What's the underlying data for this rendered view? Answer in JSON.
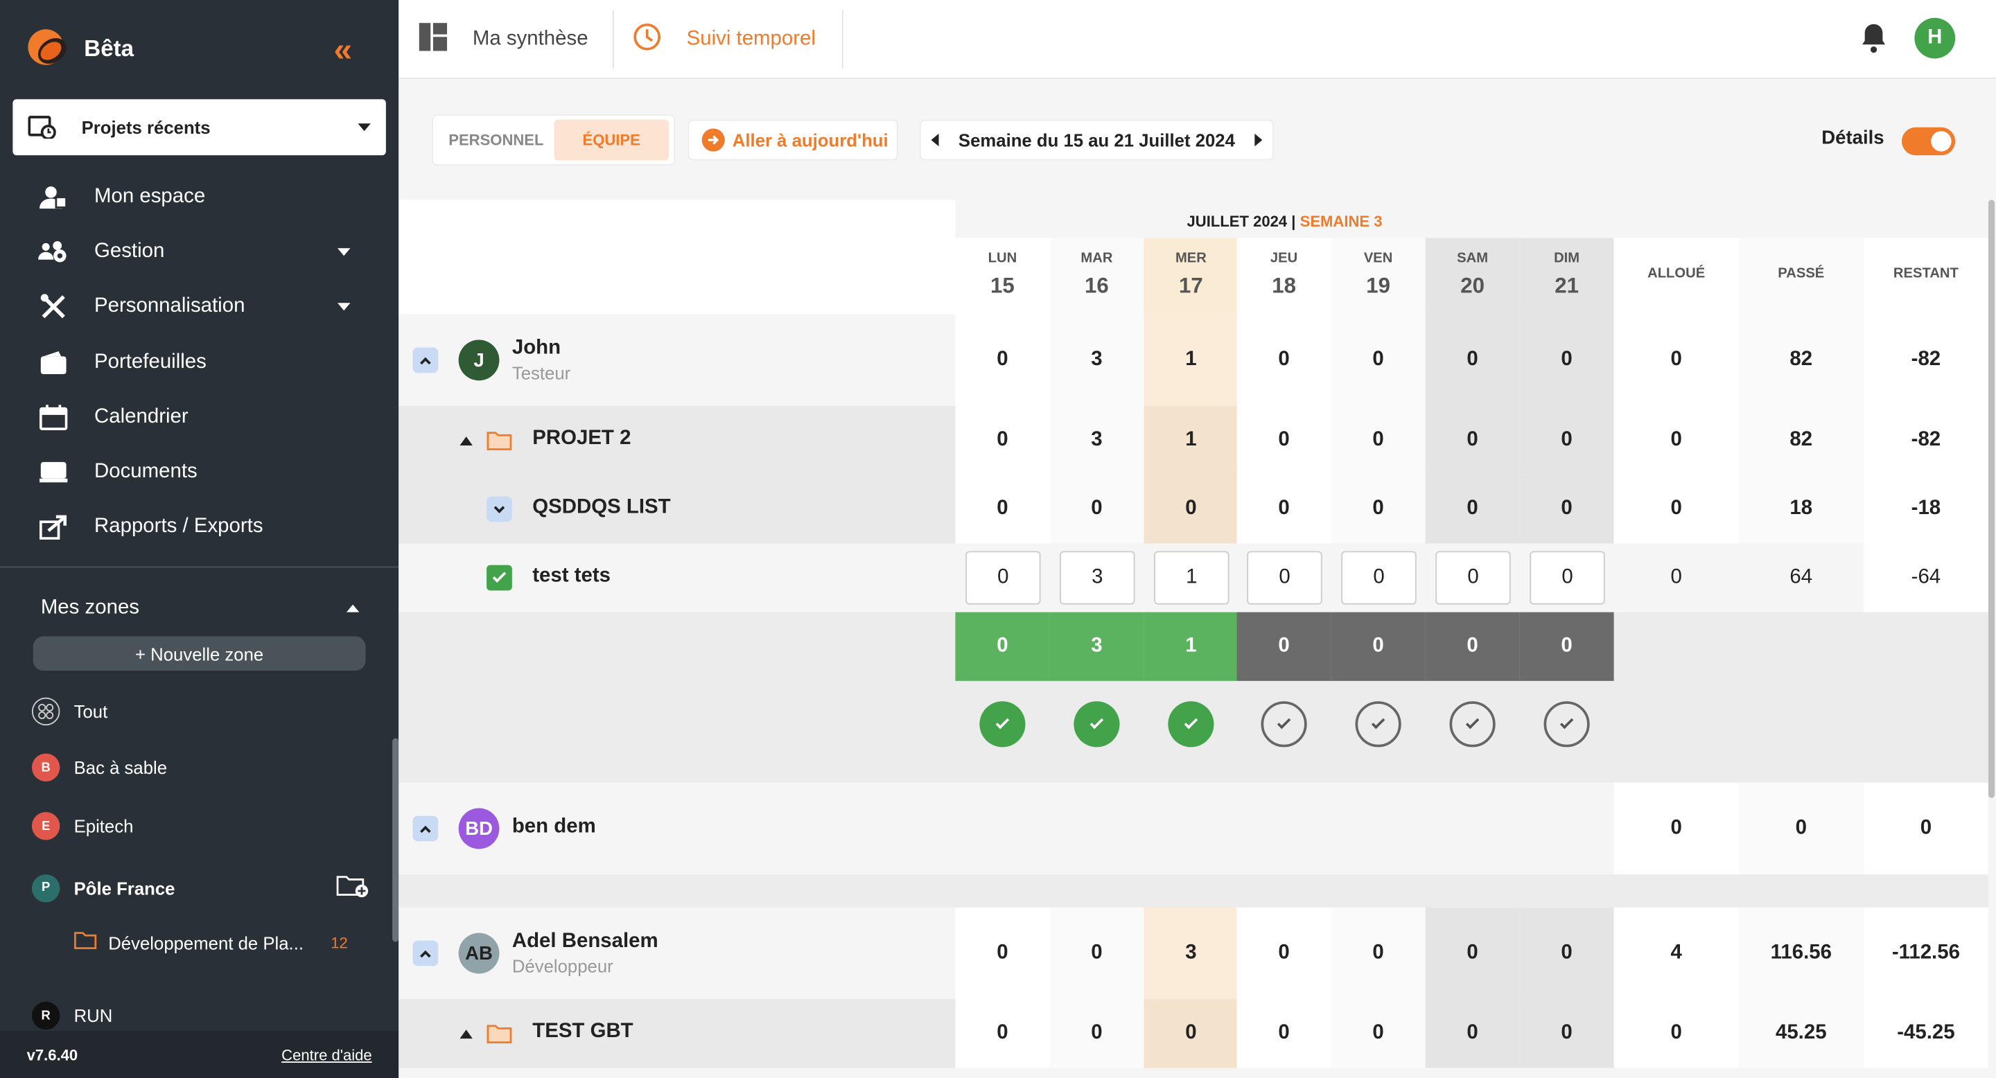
{
  "brand": {
    "name": "Bêta"
  },
  "sidebar": {
    "recent_projects": "Projets récents",
    "nav": [
      {
        "label": "Mon espace",
        "icon": "user-space-icon",
        "caret": false
      },
      {
        "label": "Gestion",
        "icon": "users-gear-icon",
        "caret": true
      },
      {
        "label": "Personnalisation",
        "icon": "tools-icon",
        "caret": true
      },
      {
        "label": "Portefeuilles",
        "icon": "wallet-icon",
        "caret": false
      },
      {
        "label": "Calendrier",
        "icon": "calendar-icon",
        "caret": false
      },
      {
        "label": "Documents",
        "icon": "documents-icon",
        "caret": false
      },
      {
        "label": "Rapports / Exports",
        "icon": "export-icon",
        "caret": false
      }
    ],
    "zones_title": "Mes zones",
    "new_zone": "+ Nouvelle zone",
    "zones": [
      {
        "label": "Tout",
        "badge": "",
        "color": ""
      },
      {
        "label": "Bac à sable",
        "badge": "B",
        "color": "#e2574c"
      },
      {
        "label": "Epitech",
        "badge": "E",
        "color": "#e2574c"
      },
      {
        "label": "Pôle France",
        "badge": "P",
        "color": "#2c6e6a"
      },
      {
        "label": "Développement de Pla...",
        "count": "12"
      },
      {
        "label": "RUN",
        "badge": "R",
        "color": "#111111"
      }
    ],
    "version": "v7.6.40",
    "help": "Centre d'aide"
  },
  "topbar": {
    "synthese": "Ma synthèse",
    "suivi": "Suivi temporel",
    "user_initial": "H"
  },
  "controls": {
    "personnel": "PERSONNEL",
    "equipe": "ÉQUIPE",
    "today": "Aller à aujourd'hui",
    "week": "Semaine du 15 au 21 Juillet 2024",
    "details": "Détails"
  },
  "header": {
    "month": "JUILLET 2024 |",
    "week": "SEMAINE 3",
    "days": [
      {
        "d": "LUN",
        "n": "15"
      },
      {
        "d": "MAR",
        "n": "16"
      },
      {
        "d": "MER",
        "n": "17"
      },
      {
        "d": "JEU",
        "n": "18"
      },
      {
        "d": "VEN",
        "n": "19"
      },
      {
        "d": "SAM",
        "n": "20"
      },
      {
        "d": "DIM",
        "n": "21"
      }
    ],
    "alloue": "ALLOUÉ",
    "passe": "PASSÉ",
    "restant": "RESTANT"
  },
  "people": [
    {
      "name": "John",
      "role": "Testeur",
      "initials": "J",
      "avatar_color": "#2f5a34",
      "days": [
        "0",
        "3",
        "1",
        "0",
        "0",
        "0",
        "0"
      ],
      "alloue": "0",
      "passe": "82",
      "restant": "-82",
      "project": {
        "name": "PROJET 2",
        "days": [
          "0",
          "3",
          "1",
          "0",
          "0",
          "0",
          "0"
        ],
        "alloue": "0",
        "passe": "82",
        "restant": "-82"
      },
      "list": {
        "name": "QSDDQS LIST",
        "days": [
          "0",
          "0",
          "0",
          "0",
          "0",
          "0",
          "0"
        ],
        "alloue": "0",
        "passe": "18",
        "restant": "-18"
      },
      "task": {
        "name": "test tets",
        "days": [
          "0",
          "3",
          "1",
          "0",
          "0",
          "0",
          "0"
        ],
        "alloue": "0",
        "passe": "64",
        "restant": "-64"
      },
      "totals": [
        "0",
        "3",
        "1",
        "0",
        "0",
        "0",
        "0"
      ],
      "validated": [
        true,
        true,
        true,
        false,
        false,
        false,
        false
      ]
    },
    {
      "name": "ben dem",
      "initials": "BD",
      "avatar_color": "#9b59e0",
      "alloue": "0",
      "passe": "0",
      "restant": "0"
    },
    {
      "name": "Adel Bensalem",
      "role": "Développeur",
      "initials": "AB",
      "avatar_color": "#8fa3a8",
      "days": [
        "0",
        "0",
        "3",
        "0",
        "0",
        "0",
        "0"
      ],
      "alloue": "4",
      "passe": "116.56",
      "restant": "-112.56",
      "project": {
        "name": "TEST GBT",
        "days": [
          "0",
          "0",
          "0",
          "0",
          "0",
          "0",
          "0"
        ],
        "alloue": "0",
        "passe": "45.25",
        "restant": "-45.25"
      }
    }
  ]
}
